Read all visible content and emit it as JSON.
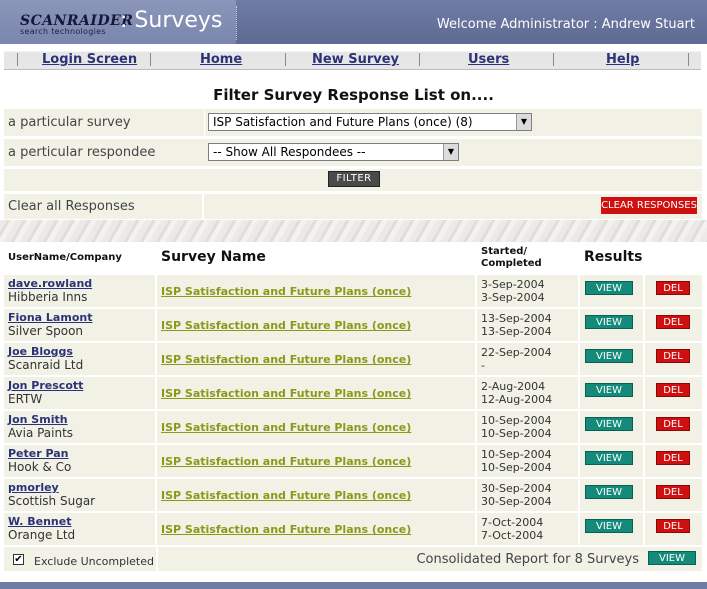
{
  "header": {
    "logo_main": "SCANRAIDER",
    "logo_sub": "search technologies",
    "app_title": ": Surveys",
    "welcome": "Welcome Administrator : Andrew Stuart"
  },
  "nav": {
    "items": [
      "Login Screen",
      "Home",
      "New Survey",
      "Users",
      "Help"
    ]
  },
  "filter": {
    "title": "Filter Survey Response List on....",
    "survey_label": "a particular survey",
    "survey_selected": "ISP Satisfaction and Future Plans (once) (8)",
    "respondee_label": "a perticular respondee",
    "respondee_selected": "-- Show All Respondees --",
    "filter_button": "FILTER",
    "clear_label": "Clear all Responses",
    "clear_button": "CLEAR RESPONSES"
  },
  "table": {
    "headers": {
      "user": "UserName/Company",
      "survey": "Survey Name",
      "started": "Started/",
      "completed": "Completed",
      "results": "Results"
    },
    "view_label": "VIEW",
    "del_label": "DEL",
    "rows": [
      {
        "user": "dave.rowland",
        "company": "Hibberia Inns",
        "survey": "ISP Satisfaction and Future Plans (once)",
        "started": "3-Sep-2004",
        "completed": "3-Sep-2004"
      },
      {
        "user": "Fiona Lamont",
        "company": "Silver Spoon",
        "survey": "ISP Satisfaction and Future Plans (once)",
        "started": "13-Sep-2004",
        "completed": "13-Sep-2004"
      },
      {
        "user": "Joe Bloggs",
        "company": "Scanraid Ltd",
        "survey": "ISP Satisfaction and Future Plans (once)",
        "started": "22-Sep-2004",
        "completed": "-"
      },
      {
        "user": "Jon Prescott",
        "company": "ERTW",
        "survey": "ISP Satisfaction and Future Plans (once)",
        "started": "2-Aug-2004",
        "completed": "12-Aug-2004"
      },
      {
        "user": "Jon Smith",
        "company": "Avia Paints",
        "survey": "ISP Satisfaction and Future Plans (once)",
        "started": "10-Sep-2004",
        "completed": "10-Sep-2004"
      },
      {
        "user": "Peter Pan",
        "company": "Hook & Co",
        "survey": "ISP Satisfaction and Future Plans (once)",
        "started": "10-Sep-2004",
        "completed": "10-Sep-2004"
      },
      {
        "user": "pmorley",
        "company": "Scottish Sugar",
        "survey": "ISP Satisfaction and Future Plans (once)",
        "started": "30-Sep-2004",
        "completed": "30-Sep-2004"
      },
      {
        "user": "W. Bennet",
        "company": "Orange Ltd",
        "survey": "ISP Satisfaction and Future Plans (once)",
        "started": "7-Oct-2004",
        "completed": "7-Oct-2004"
      }
    ]
  },
  "footer": {
    "exclude_checked": true,
    "exclude_label": "Exclude Uncompleted",
    "consolidated_label": "Consolidated Report for 8 Surveys",
    "view_label": "VIEW"
  },
  "colors": {
    "header_bg": "#6f7ca4",
    "row_bg": "#f1f1e6",
    "link_blue": "#2a3278",
    "survey_link": "#8a9a18",
    "view_green": "#148a7a",
    "danger_red": "#d01010"
  }
}
